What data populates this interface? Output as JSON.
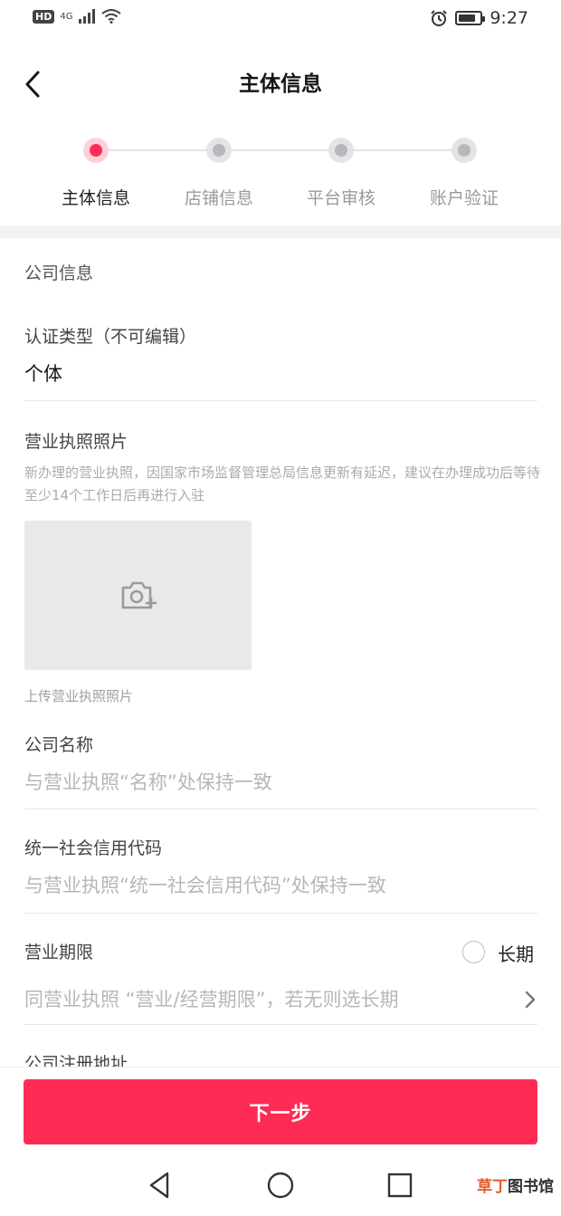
{
  "status_bar": {
    "network_hd": "HD",
    "network_gen": "4G",
    "time": "9:27",
    "battery_level_percent": 80
  },
  "header": {
    "title": "主体信息",
    "back_icon": "chevron-left-icon"
  },
  "steps": [
    {
      "label": "主体信息",
      "active": true
    },
    {
      "label": "店铺信息",
      "active": false
    },
    {
      "label": "平台审核",
      "active": false
    },
    {
      "label": "账户验证",
      "active": false
    }
  ],
  "form": {
    "section_title": "公司信息",
    "cert_type": {
      "label": "认证类型（不可编辑）",
      "value": "个体"
    },
    "license_photo": {
      "label": "营业执照照片",
      "hint": "新办理的营业执照，因国家市场监督管理总局信息更新有延迟，建议在办理成功后等待至少14个工作日后再进行入驻",
      "upload_caption": "上传营业执照照片",
      "icon": "camera-add-icon"
    },
    "company_name": {
      "label": "公司名称",
      "placeholder": "与营业执照“名称”处保持一致"
    },
    "credit_code": {
      "label": "统一社会信用代码",
      "placeholder": "与营业执照“统一社会信用代码”处保持一致"
    },
    "business_term": {
      "label": "营业期限",
      "long_term_label": "长期",
      "placeholder": "同营业执照 “营业/经营期限”，若无则选长期"
    },
    "next_field_label": "公司注册地址"
  },
  "footer": {
    "next_button": "下一步"
  },
  "watermark": {
    "brand_a": "草丁",
    "brand_b": "图书馆"
  },
  "colors": {
    "accent": "#fe2c55",
    "accent_light": "#fbd1da"
  }
}
